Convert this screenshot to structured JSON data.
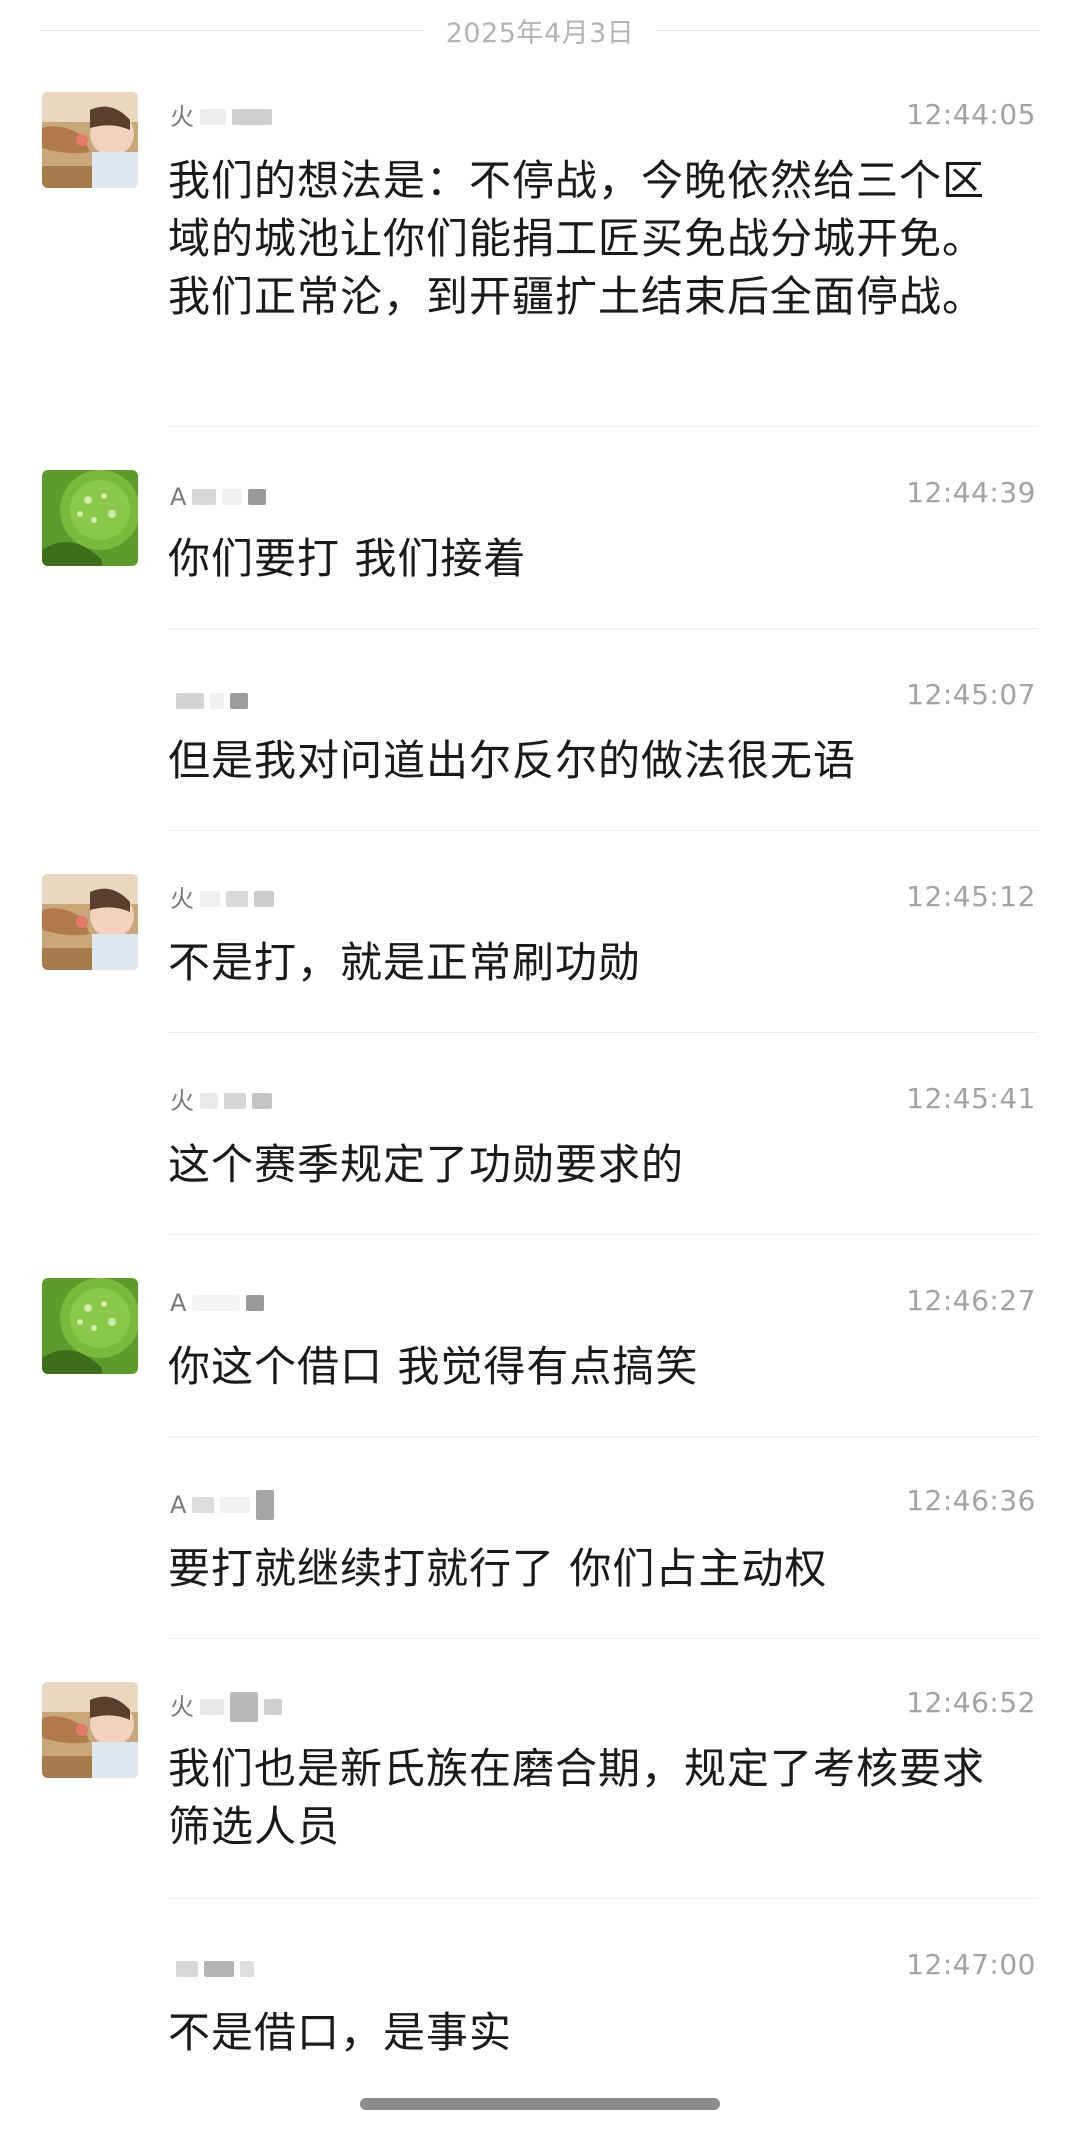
{
  "date_divider": "2025年4月3日",
  "messages": [
    {
      "name_glyph": "火",
      "time": "12:44:05",
      "text": "我们的想法是：不停战，今晚依然给三个区域的城池让你们能捐工匠买免战分城开免。我们正常沦，到开疆扩土结束后全面停战。",
      "avatar": "baby-photo-avatar"
    },
    {
      "name_glyph": "A",
      "time": "12:44:39",
      "text": "你们要打 我们接着",
      "avatar": "leaf-drops-avatar"
    },
    {
      "name_glyph": "",
      "time": "12:45:07",
      "text": "但是我对问道出尔反尔的做法很无语",
      "avatar": ""
    },
    {
      "name_glyph": "火",
      "time": "12:45:12",
      "text": "不是打，就是正常刷功勋",
      "avatar": "baby-photo-avatar"
    },
    {
      "name_glyph": "火",
      "time": "12:45:41",
      "text": "这个赛季规定了功勋要求的",
      "avatar": ""
    },
    {
      "name_glyph": "A",
      "time": "12:46:27",
      "text": "你这个借口 我觉得有点搞笑",
      "avatar": "leaf-drops-avatar"
    },
    {
      "name_glyph": "A",
      "time": "12:46:36",
      "text": "要打就继续打就行了 你们占主动权",
      "avatar": ""
    },
    {
      "name_glyph": "火",
      "time": "12:46:52",
      "text": "我们也是新氏族在磨合期，规定了考核要求筛选人员",
      "avatar": "baby-photo-avatar"
    },
    {
      "name_glyph": "",
      "time": "12:47:00",
      "text": "不是借口，是事实",
      "avatar": ""
    }
  ]
}
